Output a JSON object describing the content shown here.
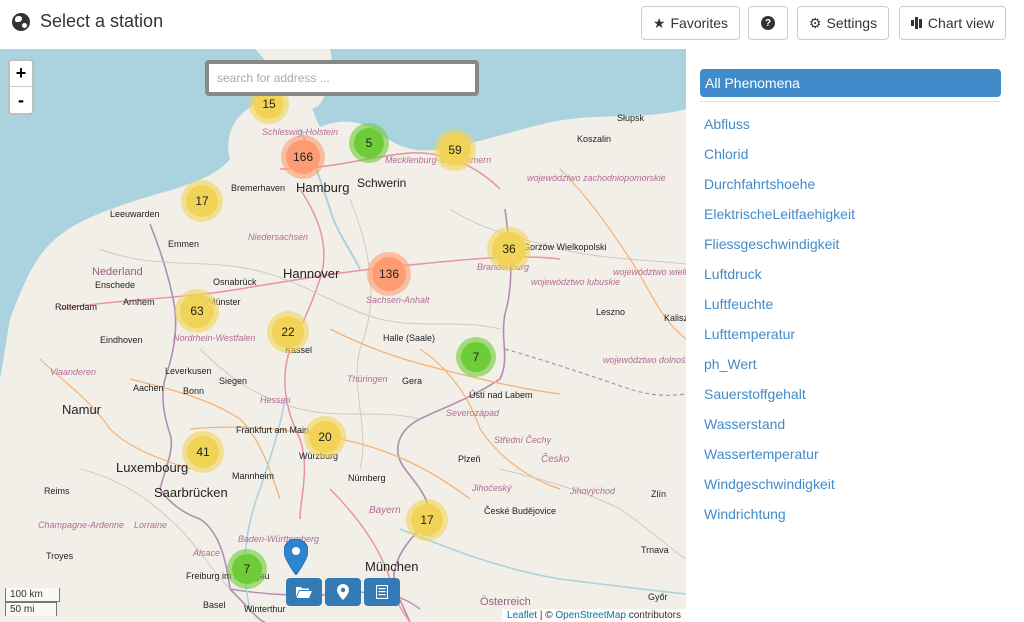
{
  "header": {
    "title": "Select a station",
    "buttons": {
      "favorites": "Favorites",
      "help": "?",
      "settings": "Settings",
      "chart_view": "Chart view"
    }
  },
  "map": {
    "zoom_in": "+",
    "zoom_out": "-",
    "search_placeholder": "search for address ...",
    "clusters": [
      {
        "count": "15",
        "color": "#f1d357"
      },
      {
        "count": "166",
        "color": "#fd9c73"
      },
      {
        "count": "5",
        "color": "#6ecc39"
      },
      {
        "count": "59",
        "color": "#f1d357"
      },
      {
        "count": "17",
        "color": "#f1d357"
      },
      {
        "count": "36",
        "color": "#f1d357"
      },
      {
        "count": "136",
        "color": "#fd9c73"
      },
      {
        "count": "63",
        "color": "#f1d357"
      },
      {
        "count": "22",
        "color": "#f1d357"
      },
      {
        "count": "7",
        "color": "#6ecc39"
      },
      {
        "count": "20",
        "color": "#f1d357"
      },
      {
        "count": "41",
        "color": "#f1d357"
      },
      {
        "count": "17",
        "color": "#f1d357"
      },
      {
        "count": "7",
        "color": "#6ecc39"
      }
    ],
    "place_labels": {
      "slupsk": "Słupsk",
      "koszalin": "Koszalin",
      "schleswig_holstein": "Schleswig-Holstein",
      "mecklenburg": "Mecklenburg-Vorpommern",
      "hamburg": "Hamburg",
      "schwerin": "Schwerin",
      "bremerhaven": "Bremerhaven",
      "leeuwarden": "Leeuwarden",
      "emmen": "Emmen",
      "niedersachsen": "Niedersachsen",
      "nederland": "Nederland",
      "enschede": "Enschede",
      "osnabruck": "Osnabrück",
      "hannover": "Hannover",
      "sachsen_anhalt": "Sachsen-Anhalt",
      "brandenburg": "Brandenburg",
      "gorzow": "Gorzów Wielkopolski",
      "arnhem": "Arnhem",
      "munster": "Münster",
      "rotterdam": "Rotterdam",
      "eindhoven": "Eindhoven",
      "nrw": "Nordrhein-Westfalen",
      "kassel": "Kassel",
      "halle": "Halle (Saale)",
      "leszno": "Leszno",
      "leverkusen": "Leverkusen",
      "siegen": "Siegen",
      "thuringen": "Thüringen",
      "gera": "Gera",
      "vlaanderen": "Vlaanderen",
      "aachen": "Aachen",
      "bonn": "Bonn",
      "usti": "Ústí nad Labem",
      "namur": "Namur",
      "hessen": "Hessen",
      "frankfurt": "Frankfurt am Main",
      "wurzburg": "Würzburg",
      "plzen": "Plzeň",
      "luxembourg": "Luxembourg",
      "mannheim": "Mannheim",
      "nurnberg": "Nürnberg",
      "reims": "Reims",
      "saarbrucken": "Saarbrücken",
      "bayern": "Bayern",
      "ceske": "České Budějovice",
      "bw": "Baden-Württemberg",
      "troyes": "Troyes",
      "alsace": "Alsace",
      "munchen": "München",
      "freiburg": "Freiburg im Breisgau",
      "basel": "Basel",
      "winterthur": "Winterthur",
      "osterreich": "Österreich",
      "lorraine": "Lorraine",
      "champagne": "Champagne-Ardenne",
      "trnava": "Trnava",
      "gyor": "Győr",
      "zlin": "Zlín",
      "wielkopolskie": "województwo wielkopolskie",
      "lubuskie": "województwo lubuskie",
      "zachodnio": "województwo zachodniopomorskie",
      "dolnoslaskie": "województwo dolnośląskie",
      "cesko": "Česko",
      "jihocesky": "Jihočeský",
      "severozapad": "Severozápad",
      "stredni_cechy": "Střední Čechy",
      "jihovychod": "Jihovýchod",
      "kalisz": "Kalisz"
    },
    "scale": {
      "metric": "100 km",
      "imperial": "50 mi"
    },
    "attribution": {
      "leaflet": "Leaflet",
      "sep": " | © ",
      "osm": "OpenStreetMap",
      "suffix": " contributors"
    }
  },
  "phenomena": {
    "all_label": "All Phenomena",
    "items": [
      "Abfluss",
      "Chlorid",
      "Durchfahrtshoehe",
      "ElektrischeLeitfaehigkeit",
      "Fliessgeschwindigkeit",
      "Luftdruck",
      "Luftfeuchte",
      "Lufttemperatur",
      "ph_Wert",
      "Sauerstoffgehalt",
      "Wasserstand",
      "Wassertemperatur",
      "Windgeschwindigkeit",
      "Windrichtung"
    ]
  },
  "colors": {
    "primary": "#428bca",
    "tool_button": "#337ab7",
    "sea": "#aad3df",
    "land": "#f2efe9",
    "cluster_small": "#6ecc39",
    "cluster_medium": "#f1d357",
    "cluster_large": "#fd9c73"
  }
}
